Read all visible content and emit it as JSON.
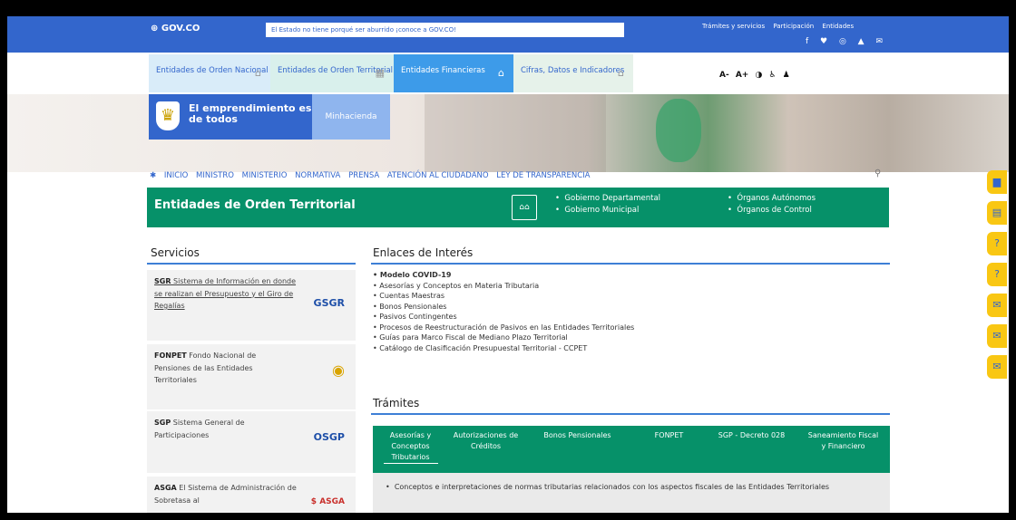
{
  "govbar": {
    "logo": "⊕ GOV.CO",
    "message": "El Estado no tiene porqué ser aburrido ¡conoce a GOV.CO!",
    "links": [
      "Trámites y servicios",
      "Participación",
      "Entidades"
    ],
    "social": "f ♥ ◎ ▲ ✉"
  },
  "entities": [
    {
      "label": "Entidades de Orden Nacional",
      "icon": "building-icon"
    },
    {
      "label": "Entidades de Orden Territorial",
      "icon": "map-icon"
    },
    {
      "label": "Entidades Financieras",
      "icon": "bank-icon"
    },
    {
      "label": "Cifras, Datos e Indicadores",
      "icon": "bank-icon"
    }
  ],
  "accessibility": "A- A+ ◑ ♿ ♟",
  "brand": {
    "text": "El emprendimiento es de todos",
    "ministry": "Minhacienda"
  },
  "nav": [
    "INICIO",
    "MINISTRO",
    "MINISTERIO",
    "NORMATIVA",
    "PRENSA",
    "ATENCIÓN AL CIUDADANO",
    "LEY DE TRANSPARENCIA"
  ],
  "banner": {
    "title": "Entidades de Orden Territorial",
    "col1": [
      "Gobierno Departamental",
      "Gobierno Municipal"
    ],
    "col2": [
      "Órganos Autónomos",
      "Órganos de Control"
    ]
  },
  "servicios": {
    "title": "Servicios",
    "items": [
      {
        "bold": "SGR",
        "text": " Sistema de Información en donde se realizan el Presupuesto y el Giro de Regalías",
        "logo": "GSGR"
      },
      {
        "bold": "FONPET",
        "text": " Fondo Nacional de Pensiones de las Entidades Territoriales",
        "logo": "◉"
      },
      {
        "bold": "SGP",
        "text": " Sistema General de Participaciones",
        "logo": "OSGP"
      },
      {
        "bold": "ASGA",
        "text": " El Sistema de Administración de Sobretasa al",
        "logo": "$ ASGA"
      }
    ]
  },
  "enlaces": {
    "title": "Enlaces de Interés",
    "items": [
      "Modelo COVID-19",
      "Asesorías y Conceptos en Materia Tributaria",
      "Cuentas Maestras",
      "Bonos Pensionales",
      "Pasivos Contingentes",
      "Procesos de Reestructuración de Pasivos en las Entidades Territoriales",
      "Guías para Marco Fiscal de Mediano Plazo Territorial",
      "Catálogo de Clasificación Presupuestal Territorial - CCPET"
    ]
  },
  "tramites": {
    "title": "Trámites",
    "tabs": [
      "Asesorías y Conceptos Tributarios",
      "Autorizaciones de Créditos",
      "Bonos Pensionales",
      "FONPET",
      "SGP - Decreto 028",
      "Saneamiento Fiscal y Financiero"
    ],
    "content": "Conceptos e interpretaciones de normas tributarias relacionados con los aspectos fiscales de las Entidades Territoriales"
  },
  "side_buttons": [
    "▆",
    "▤",
    "?",
    "?",
    "✉",
    "✉",
    "✉"
  ]
}
